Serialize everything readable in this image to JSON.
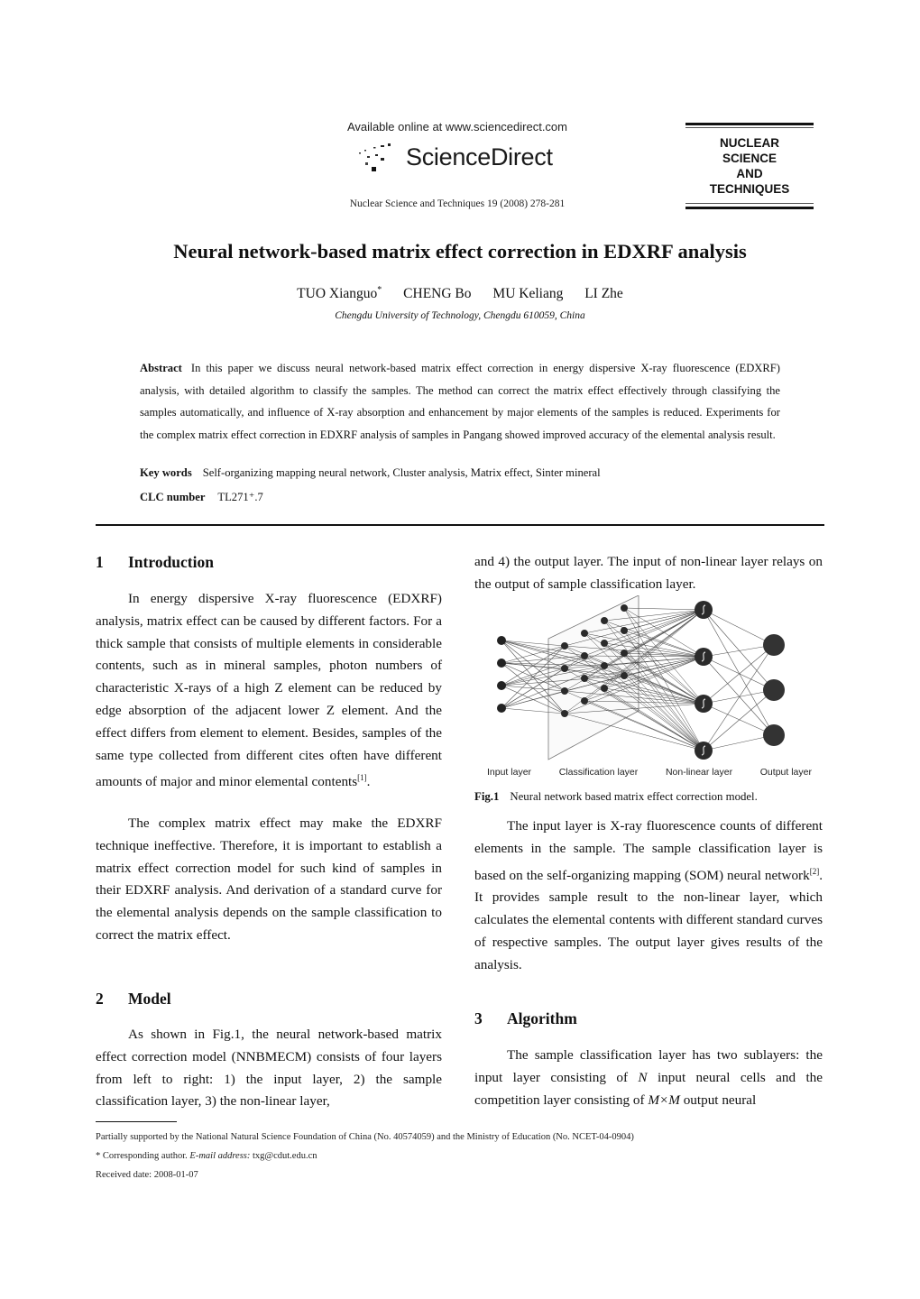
{
  "header": {
    "available_online": "Available online at www.sciencedirect.com",
    "publisher_logo_text": "ScienceDirect",
    "publisher_logo_icon": "sciencedirect-dots-icon",
    "journal_reference": "Nuclear Science and Techniques 19 (2008) 278-281",
    "journal_box_lines": [
      "NUCLEAR",
      "SCIENCE",
      "AND",
      "TECHNIQUES"
    ]
  },
  "paper": {
    "title": "Neural network-based matrix effect correction in EDXRF analysis",
    "authors": [
      {
        "name": "TUO Xianguo",
        "mark": "*"
      },
      {
        "name": "CHENG Bo",
        "mark": ""
      },
      {
        "name": "MU Keliang",
        "mark": ""
      },
      {
        "name": "LI Zhe",
        "mark": ""
      }
    ],
    "affiliation": "Chengdu University of Technology, Chengdu 610059, China",
    "abstract_label": "Abstract",
    "abstract_text": "In this paper we discuss neural network-based matrix effect correction in energy dispersive X-ray fluorescence (EDXRF) analysis, with detailed algorithm to classify the samples. The method can correct the matrix effect effectively through classifying the samples automatically, and influence of X-ray absorption and enhancement by major elements of the samples is reduced. Experiments for the complex matrix effect correction in EDXRF analysis of samples in Pangang showed improved accuracy of the elemental analysis result.",
    "keywords_label": "Key words",
    "keywords": "Self-organizing mapping neural network, Cluster analysis, Matrix effect, Sinter mineral",
    "clc_label": "CLC number",
    "clc_value": "TL271⁺.7"
  },
  "sections": {
    "intro": {
      "num": "1",
      "heading": "Introduction",
      "p1": "In energy dispersive X-ray fluorescence (EDXRF) analysis, matrix effect can be caused by different factors. For a thick sample that consists of multiple elements in considerable contents, such as in mineral samples, photon numbers of characteristic X-rays of a high Z element can be reduced by edge absorption of the adjacent lower Z element. And the effect differs from element to element. Besides, samples of the same type collected from different cites often have different amounts of major and minor elemental contents",
      "p1_ref": "[1]",
      "p1_end": ".",
      "p2": "The complex matrix effect may make the EDXRF technique ineffective. Therefore, it is important to establish a matrix effect correction model for such kind of samples in their EDXRF analysis. And derivation of a standard curve for the elemental analysis depends on the sample classification to correct the matrix effect."
    },
    "model": {
      "num": "2",
      "heading": "Model",
      "p1": "As shown in Fig.1, the neural network-based matrix effect correction model (NNBMECM) consists of four layers from left to right: 1) the input layer, 2) the sample classification layer, 3) the non-linear layer,",
      "p1_cont": "and 4) the output layer. The input of non-linear layer relays on the output of sample classification layer.",
      "p2_a": "The input layer is X-ray fluorescence counts of different elements in the sample. The sample classification layer is based on the self-organizing mapping (SOM) neural network",
      "p2_ref": "[2]",
      "p2_b": ". It provides sample result to the non-linear layer, which calculates the elemental contents with different standard curves of respective samples. The output layer gives results of the analysis."
    },
    "algorithm": {
      "num": "3",
      "heading": "Algorithm",
      "p1_a": "The sample classification layer has two sublayers: the input layer consisting of ",
      "p1_n": "N",
      "p1_b": " input neural cells and the competition layer consisting of ",
      "p1_mm": "M×M",
      "p1_c": " output neural"
    }
  },
  "figure": {
    "layer_labels": [
      "Input layer",
      "Classification layer",
      "Non-linear layer",
      "Output layer"
    ],
    "caption_label": "Fig.1",
    "caption_text": "Neural network based matrix effect correction model.",
    "node_counts": {
      "input": 4,
      "classification_grid": "4x4",
      "nonlinear": 4,
      "output": 3
    }
  },
  "footnotes": {
    "funding": "Partially supported by the National Natural Science Foundation of China (No. 40574059) and the Ministry of Education (No. NCET-04-0904)",
    "corresponding_prefix": "* Corresponding author. ",
    "email_label": "E-mail address:",
    "email": " txg@cdut.edu.cn",
    "received": "Received date: 2008-01-07"
  }
}
